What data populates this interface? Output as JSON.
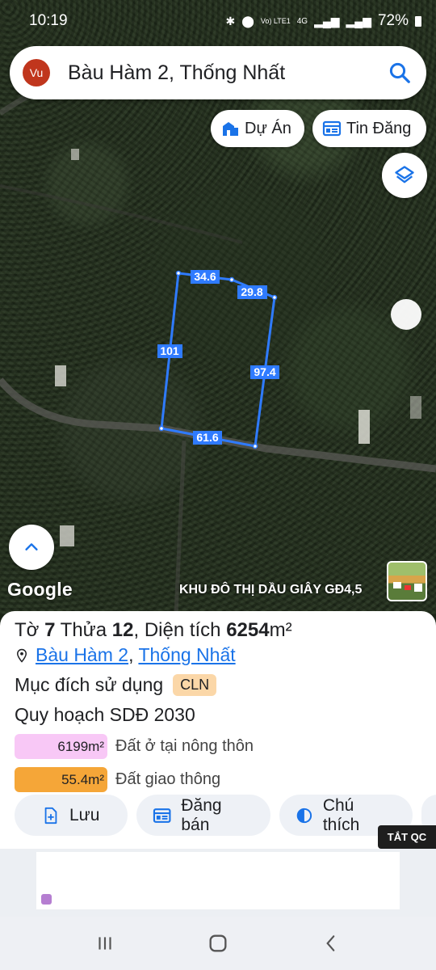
{
  "status": {
    "time": "10:19",
    "battery": "72%",
    "network": "4G",
    "carrier": "Vo) LTE1"
  },
  "search": {
    "avatar": "Vu",
    "query": "Bàu Hàm 2, Thống Nhất"
  },
  "chips": {
    "du_an": "Dự Án",
    "tin_dang": "Tin Đăng"
  },
  "map": {
    "brand": "Google",
    "project_label": "KHU ĐÔ THỊ DẦU GIÂY GĐ4,5",
    "edges": [
      "34.6",
      "29.8",
      "101",
      "97.4",
      "61.6"
    ]
  },
  "parcel": {
    "to_label": "Tờ",
    "to_value": "7",
    "thua_label": "Thửa",
    "thua_value": "12",
    "dientich_label": "Diện tích",
    "dientich_value": "6254",
    "unit": "m²",
    "commune": "Bàu Hàm 2",
    "separator": ",",
    "district": "Thống Nhất",
    "purpose_label": "Mục đích sử dụng",
    "purpose_code": "CLN",
    "plan_label": "Quy hoạch SDĐ 2030",
    "landuse": [
      {
        "area": "6199m²",
        "label": "Đất ở tại nông thôn",
        "color": "#f8c8f6"
      },
      {
        "area": "55.4m²",
        "label": "Đất giao thông",
        "color": "#f5a638"
      }
    ]
  },
  "actions": {
    "save": "Lưu",
    "sell": "Đăng bán",
    "legend": "Chú thích"
  },
  "ad": {
    "close_label": "TẮT QC"
  },
  "colors": {
    "accent": "#1a73e8",
    "parcel_line": "#2f7bff",
    "avatar": "#c0361d"
  }
}
